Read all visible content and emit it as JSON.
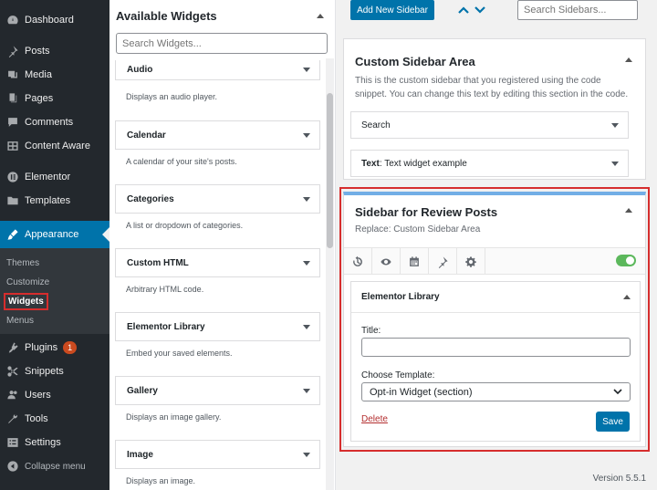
{
  "admin_menu": {
    "items": [
      {
        "label": "Dashboard",
        "icon": "dashboard-icon"
      },
      {
        "label": "Posts",
        "icon": "pin-icon"
      },
      {
        "label": "Media",
        "icon": "media-icon"
      },
      {
        "label": "Pages",
        "icon": "pages-icon"
      },
      {
        "label": "Comments",
        "icon": "comments-icon"
      },
      {
        "label": "Content Aware",
        "icon": "grid-icon"
      },
      {
        "label": "Elementor",
        "icon": "elementor-icon"
      },
      {
        "label": "Templates",
        "icon": "folder-icon"
      },
      {
        "label": "Appearance",
        "icon": "brush-icon"
      },
      {
        "label": "Plugins",
        "icon": "plugin-icon",
        "badge": "1"
      },
      {
        "label": "Snippets",
        "icon": "scissors-icon"
      },
      {
        "label": "Users",
        "icon": "users-icon"
      },
      {
        "label": "Tools",
        "icon": "wrench-icon"
      },
      {
        "label": "Settings",
        "icon": "settings-icon"
      },
      {
        "label": "Collapse menu",
        "icon": "collapse-icon"
      }
    ],
    "appearance_submenu": [
      "Themes",
      "Customize",
      "Widgets",
      "Menus"
    ]
  },
  "available_widgets": {
    "title": "Available Widgets",
    "search_placeholder": "Search Widgets...",
    "widgets": [
      {
        "name": "Audio",
        "desc": "Displays an audio player."
      },
      {
        "name": "Calendar",
        "desc": "A calendar of your site's posts."
      },
      {
        "name": "Categories",
        "desc": "A list or dropdown of categories."
      },
      {
        "name": "Custom HTML",
        "desc": "Arbitrary HTML code."
      },
      {
        "name": "Elementor Library",
        "desc": "Embed your saved elements."
      },
      {
        "name": "Gallery",
        "desc": "Displays an image gallery."
      },
      {
        "name": "Image",
        "desc": "Displays an image."
      }
    ]
  },
  "toolbar": {
    "add_label": "Add New Sidebar",
    "search_placeholder": "Search Sidebars..."
  },
  "custom_area": {
    "title": "Custom Sidebar Area",
    "desc": "This is the custom sidebar that you registered using the code snippet. You can change this text by editing this section in the code.",
    "widgets": [
      {
        "label": "Search",
        "prefix": "",
        "suffix": ""
      },
      {
        "label": "Text",
        "suffix": ": Text widget example"
      }
    ]
  },
  "review": {
    "title": "Sidebar for Review Posts",
    "subtitle": "Replace: Custom Sidebar Area",
    "icons": [
      "history-icon",
      "eye-icon",
      "calendar-icon",
      "pin-icon",
      "gear-icon"
    ],
    "toggle_on": true,
    "widget": {
      "title": "Elementor Library",
      "title_label": "Title:",
      "title_value": "",
      "template_label": "Choose Template:",
      "template_value": "Opt-in Widget (section)",
      "delete_label": "Delete",
      "save_label": "Save"
    }
  },
  "footer": {
    "version": "Version 5.5.1"
  },
  "colors": {
    "accent": "#0073aa",
    "highlight": "#d62d2d",
    "menu_bg": "#23282d",
    "toggle": "#5cb85c"
  }
}
